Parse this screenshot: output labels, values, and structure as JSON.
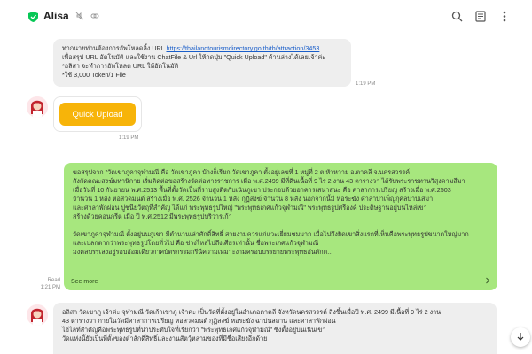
{
  "header": {
    "contact_name": "Alisa",
    "icons": [
      "shield-check-icon",
      "mute-icon",
      "link-icon",
      "search-icon",
      "notes-icon",
      "more-vertical-icon"
    ]
  },
  "messages": [
    {
      "id": "m1",
      "sender": "bot",
      "lines": [
        "ทากนายท่านต้องการอัพโหลดลิ้ง URL ",
        "เพื่อสรุป URL อัตโนมัติ และใช้งาน ChatFile & Url ให้กดปุ่ม \"Quick Upload\" ด้านล่างได้เลยเจ้าค่ะ",
        "*อลิสา จะทำการอัพโหลด URL ให้อัตโนมัติ",
        "*ใช้ 3,000 Token/1 File"
      ],
      "link": "https://thailandtourismdirectory.go.th/th/attraction/3453",
      "time": "1:19 PM"
    },
    {
      "id": "m2",
      "sender": "bot",
      "button_label": "Quick Upload",
      "time": "1:19 PM"
    },
    {
      "id": "m3",
      "sender": "user",
      "lines": [
        "ขอสรุปจาก \"วัดเขาภูคาจุฬามณี คือ วัดเขาภูคา บ้างก็เรียก วัดเขาภูคา ตั้งอยู่เลขที่ 1 หมู่ที่ 2 ต.หัวหวาย อ.ตาคลี จ.นครสวรรค์",
        "สังกัดคณะสงฆ์มหานิกาย เริ่มติดต่อขอสร้างวัดต่อทางราชการ เมื่อ พ.ศ.2499 มีที่ดินเนื้อที่ 9 ไร่ 2 งาน 43 ตารางวา ได้รับพระราชทานวิสุงคามสีมา",
        "เมื่อวันที่ 10 กันยายน พ.ศ.2513 พื้นที่ตั้งวัดเป็นที่ราบสูงติดกับเนินภูเขา ประกอบด้วยอาคารเสนาสนะ คือ ศาลาการเปรียญ สร้างเมื่อ พ.ศ.2503",
        "จำนวน 1 หลัง หอสวดมนต์ สร้างเมื่อ พ.ศ. 2526 จำนวน 1 หลัง กุฏิสงฆ์ จำนวน 8 หลัง นอกจากนี้มี หอระฆัง ศาลาบำเพ็ญกุศลบาปเสมา",
        "และศาลาพักผ่อน ปูชนียวัตถุที่สำคัญ ได้แก่ พระพุทธรูปใหญ่ \"พระพุทธเกศแก้วจุฬามณี\" พระพุทธรูปศรีองค์ ประดิษฐานอยู่บนไหล่เขา",
        "สร้างด้วยคอนกรีต เมื่อ ปี พ.ศ.2512 มีพระพุทธรูปบริวารเก้า",
        "",
        "วัดเขาภูคาจุฬามณี ตั้งอยู่บนภูเขา มีตำนานเล่าศักดิ์สิทธิ์ สวยงามควรแก่แวะเยี่ยมชมมาก เมื่อไปถึงยิดเขาสิ่งแรกที่เห็นคือพระพุทธรูปขนาดใหญ่มาก",
        "และเปลกตากว่าพระพุทธรูปโดยทั่วไป คือ ช่วงไหล่ไปถึงเศียรเท่านั้น ชื่อพระเกศแก้วจุฬามณี",
        "มงคลบรรเลงอยู่รอบอ้อมเดียวกาศบัตรกรรมกรีนีความเหมาะงามครอบบรรยายพระพุทธอันศักด..."
      ],
      "see_more": "See more",
      "read_status": "Read",
      "time": "1:21 PM"
    },
    {
      "id": "m4",
      "sender": "bot",
      "lines": [
        "อลิสา วัดเขาภู เจ้าค่ะ จุฬามณี วัดเก้าเขาภู เจ้าค่ะ เป็นวัดที่ตั้งอยู่ในอำเภอตาคลี จังหวัดนครสวรรค์ สิ่งขึ้นเมื่อปี พ.ศ. 2499 มีเนื้อที่ 9 ไร่ 2 งาน",
        "43 ตารางวา ภายในวัดมีศาลาการเปรียญ หอสวดมนต์ กุฏิสงฆ์ หอระฆัง ฉาปนสถาน และศาลาพักผ่อน",
        "ไฮไลท์สำคัญคือพระพุทธรูปที่น่าประทับใจที่เรียกว่า \"พระพุทธเกศแก้วจุฬามณี\" ซึ่งตั้งอยู่บนเนินเขา",
        "วัดแห่งนี้ยังเป็นที่ตั้งของตำสักดิ์สิทธิ์และงานสัตว์ุหลามของที่มีชื่อเสียงอีกด้วย"
      ]
    }
  ]
}
